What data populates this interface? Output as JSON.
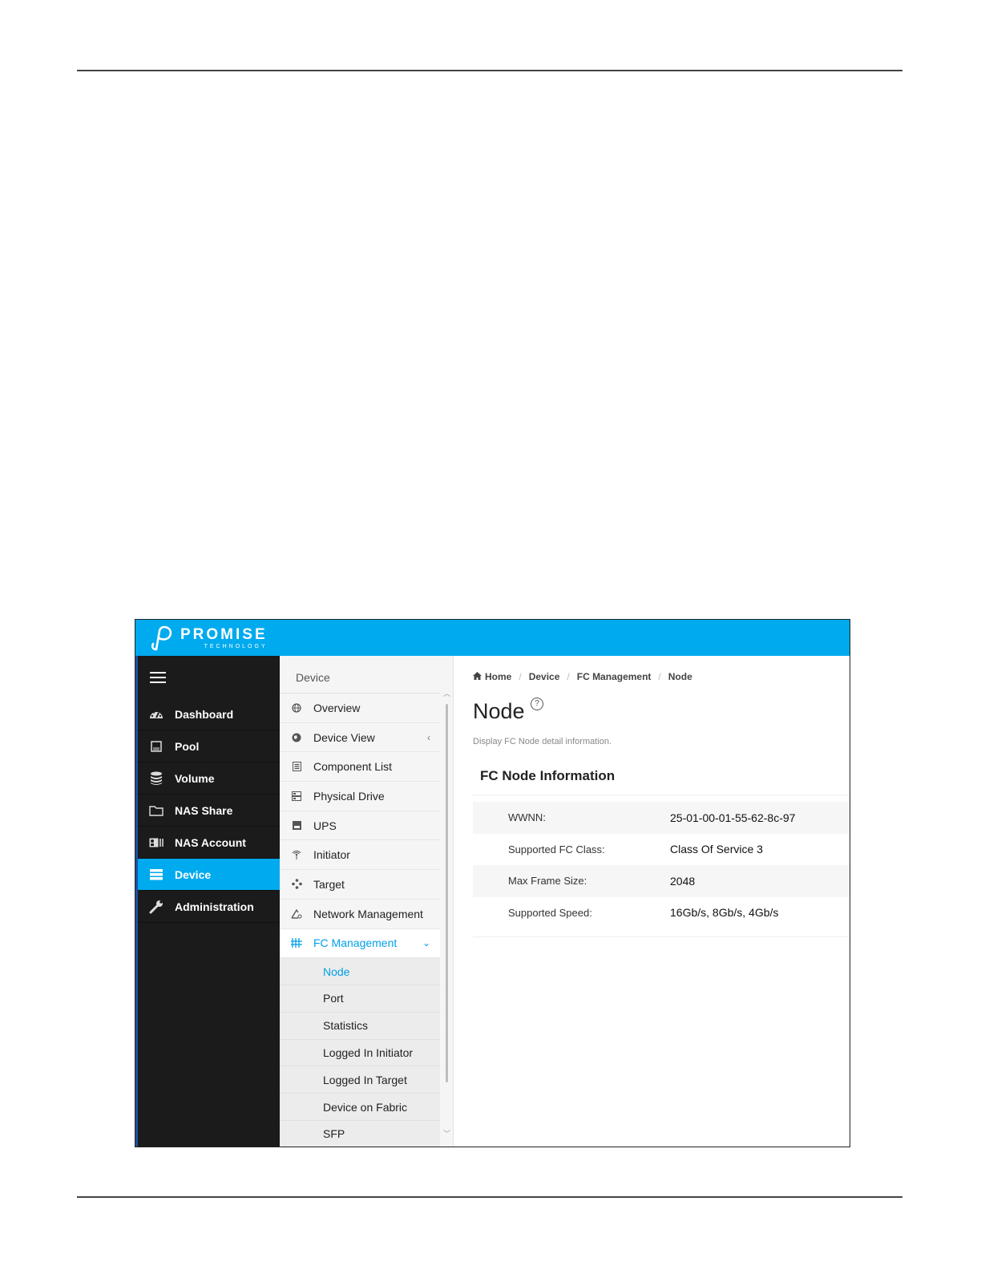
{
  "brand": {
    "name": "PROMISE",
    "sub": "TECHNOLOGY"
  },
  "sidebar": {
    "items": [
      {
        "label": "Dashboard",
        "icon": "dashboard-icon"
      },
      {
        "label": "Pool",
        "icon": "pool-icon"
      },
      {
        "label": "Volume",
        "icon": "database-icon"
      },
      {
        "label": "NAS Share",
        "icon": "folder-icon"
      },
      {
        "label": "NAS Account",
        "icon": "id-card-icon"
      },
      {
        "label": "Device",
        "icon": "device-icon",
        "active": true
      },
      {
        "label": "Administration",
        "icon": "wrench-icon"
      }
    ]
  },
  "subnav": {
    "heading": "Device",
    "items": [
      {
        "label": "Overview",
        "icon": "globe-icon"
      },
      {
        "label": "Device View",
        "icon": "device-view-icon"
      },
      {
        "label": "Component List",
        "icon": "list-icon"
      },
      {
        "label": "Physical Drive",
        "icon": "drive-icon"
      },
      {
        "label": "UPS",
        "icon": "ups-icon"
      },
      {
        "label": "Initiator",
        "icon": "antenna-icon"
      },
      {
        "label": "Target",
        "icon": "target-icon"
      },
      {
        "label": "Network Management",
        "icon": "network-icon"
      },
      {
        "label": "FC Management",
        "icon": "fc-icon",
        "active": true
      }
    ],
    "children": [
      {
        "label": "Node",
        "active": true
      },
      {
        "label": "Port"
      },
      {
        "label": "Statistics"
      },
      {
        "label": "Logged In Initiator"
      },
      {
        "label": "Logged In Target"
      },
      {
        "label": "Device on Fabric"
      },
      {
        "label": "SFP"
      }
    ]
  },
  "breadcrumb": [
    "Home",
    "Device",
    "FC Management",
    "Node"
  ],
  "page": {
    "title": "Node",
    "description": "Display FC Node detail information.",
    "section_title": "FC Node Information",
    "rows": [
      {
        "key": "WWNN:",
        "value": "25-01-00-01-55-62-8c-97"
      },
      {
        "key": "Supported FC Class:",
        "value": "Class Of Service 3"
      },
      {
        "key": "Max Frame Size:",
        "value": "2048"
      },
      {
        "key": "Supported Speed:",
        "value": "16Gb/s, 8Gb/s, 4Gb/s"
      }
    ]
  },
  "colors": {
    "accent": "#00aaee",
    "sidebar_bg": "#1b1b1b",
    "active_text": "#00a0e6"
  }
}
